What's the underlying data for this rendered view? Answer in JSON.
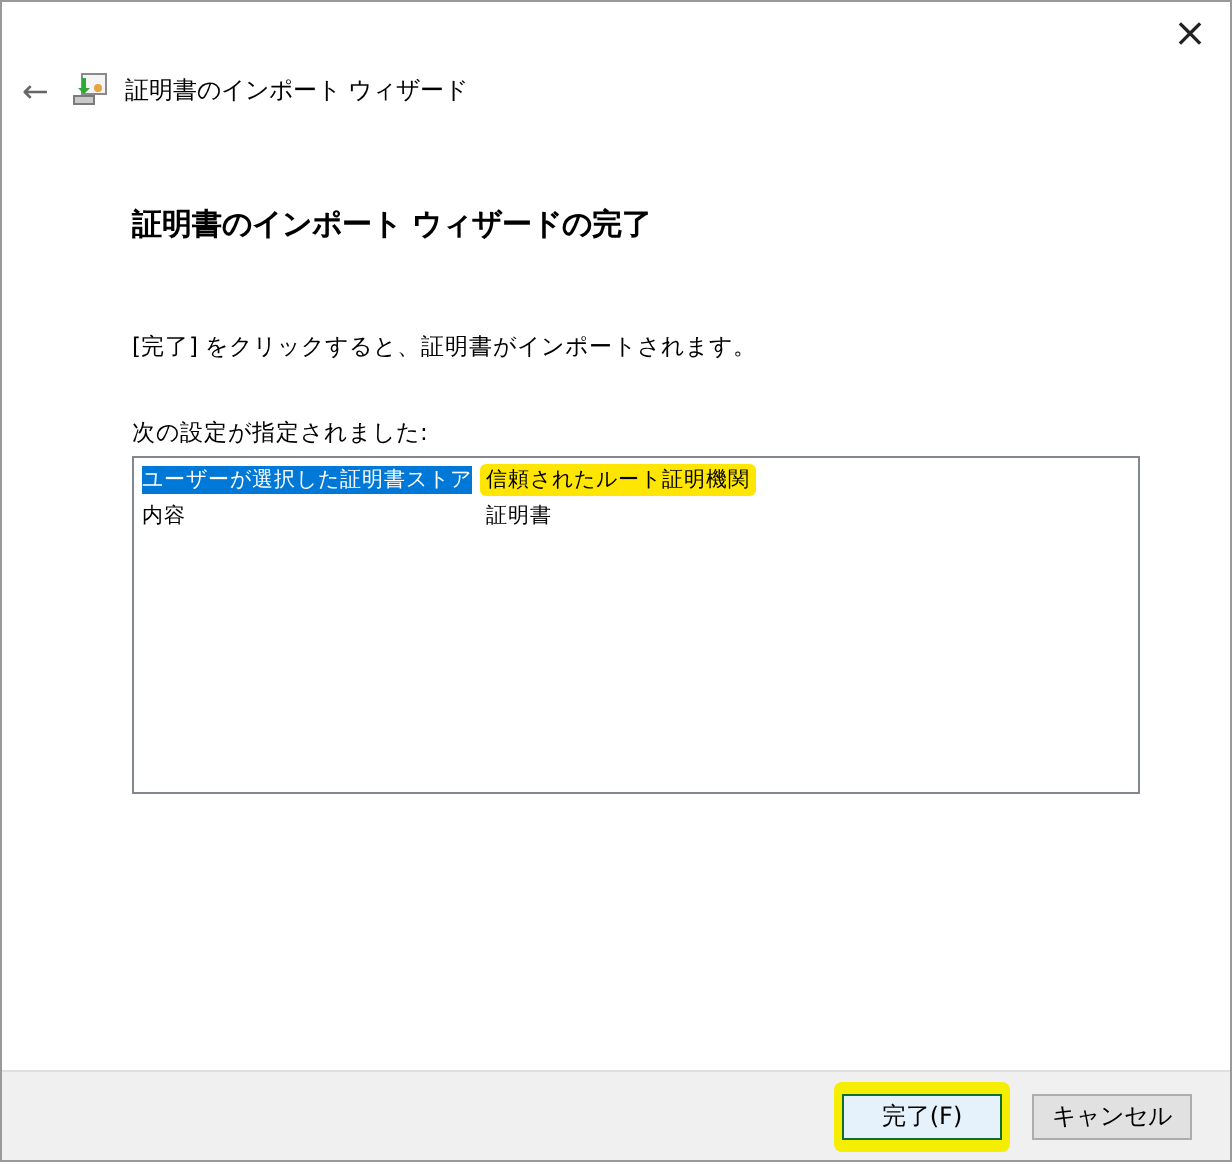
{
  "window": {
    "title": "証明書のインポート ウィザード",
    "close": "×",
    "back": "←"
  },
  "heading": "証明書のインポート ウィザードの完了",
  "instruction": "[完了] をクリックすると、証明書がインポートされます。",
  "settings": {
    "label": "次の設定が指定されました:",
    "rows": [
      {
        "selected": true,
        "cells": [
          {
            "text": "ユーザーが選択した証明書ストア",
            "highlighted": false
          },
          {
            "text": "信頼されたルート証明機関",
            "highlighted": true
          }
        ]
      },
      {
        "selected": false,
        "cells": [
          {
            "text": "内容",
            "highlighted": false
          },
          {
            "text": "証明書",
            "highlighted": false
          }
        ]
      }
    ]
  },
  "buttons": [
    {
      "label": "完了(F)",
      "default": true,
      "highlighted": true
    },
    {
      "label": "キャンセル",
      "default": false,
      "highlighted": false
    }
  ]
}
